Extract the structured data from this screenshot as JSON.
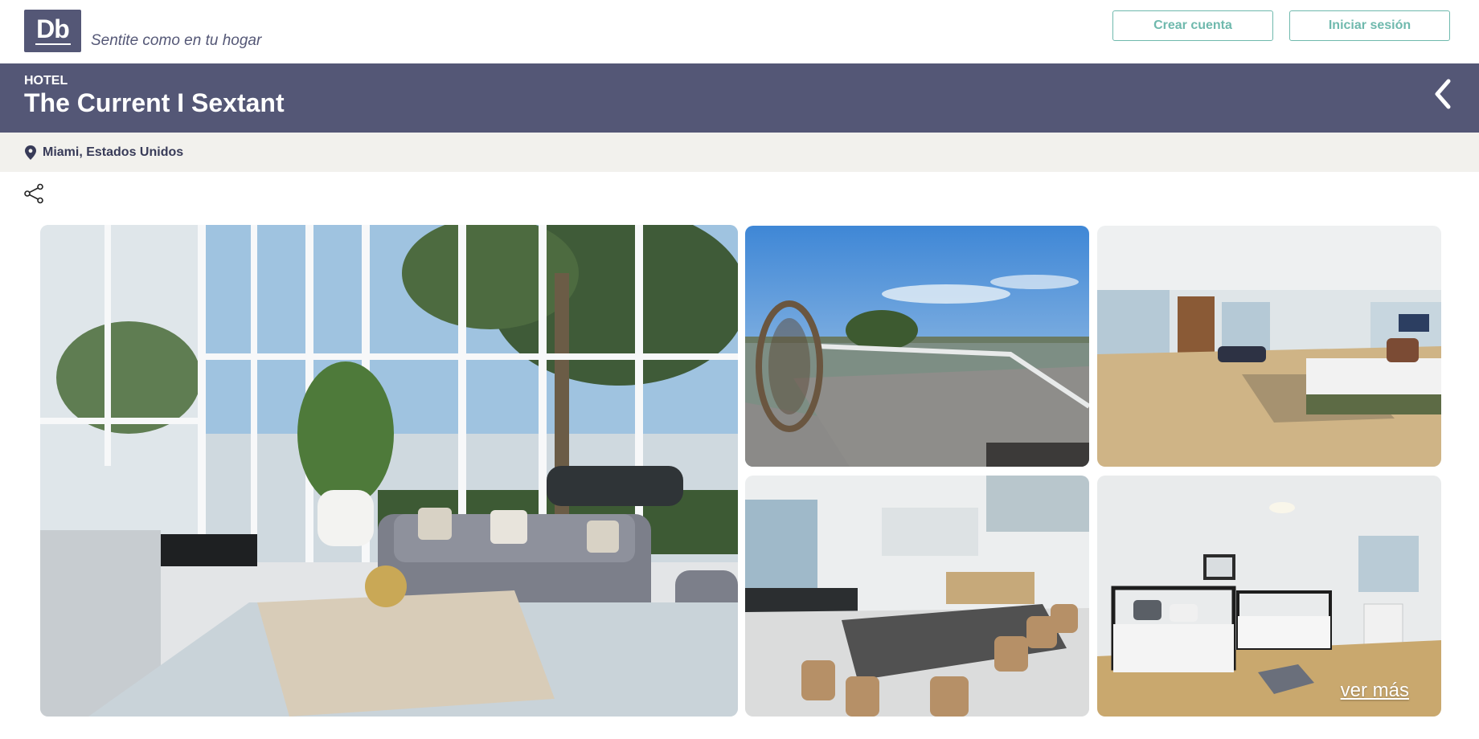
{
  "header": {
    "logo_text": "Db",
    "tagline": "Sentite como en tu hogar",
    "create_account_label": "Crear cuenta",
    "login_label": "Iniciar sesión"
  },
  "product": {
    "category": "HOTEL",
    "name": "The Current I Sextant",
    "location": "Miami, Estados Unidos"
  },
  "gallery": {
    "more_label": "ver más",
    "images": [
      {
        "name": "lobby-photo"
      },
      {
        "name": "balcony-photo"
      },
      {
        "name": "bedroom-photo"
      },
      {
        "name": "dining-photo"
      },
      {
        "name": "twin-bedroom-photo"
      }
    ]
  },
  "colors": {
    "brand": "#545776",
    "accent": "#6fb9ad",
    "location_bg": "#f2f1ed"
  },
  "icons": [
    "back-chevron-icon",
    "location-pin-icon",
    "share-icon"
  ]
}
